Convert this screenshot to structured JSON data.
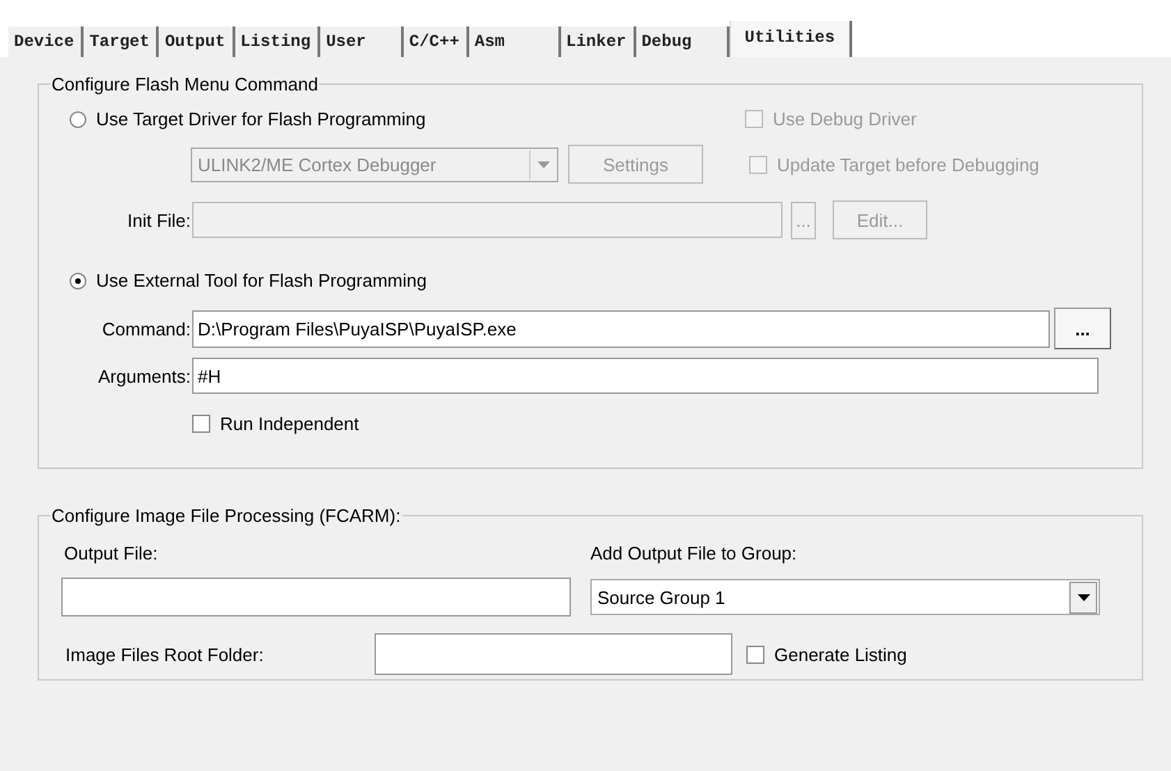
{
  "tabs": [
    {
      "label": "Device",
      "selected": false
    },
    {
      "label": "Target",
      "selected": false
    },
    {
      "label": "Output",
      "selected": false
    },
    {
      "label": "Listing",
      "selected": false
    },
    {
      "label": "User",
      "selected": false
    },
    {
      "label": "C/C++",
      "selected": false
    },
    {
      "label": "Asm",
      "selected": false
    },
    {
      "label": "Linker",
      "selected": false
    },
    {
      "label": "Debug",
      "selected": false
    },
    {
      "label": "Utilities",
      "selected": true
    }
  ],
  "flash_menu": {
    "title": "Configure Flash Menu Command",
    "target_driver": {
      "label": "Use Target Driver for Flash Programming",
      "selected": false
    },
    "use_debug_driver": {
      "label": "Use Debug Driver",
      "checked": false,
      "disabled": true
    },
    "driver": {
      "value": "ULINK2/ME Cortex Debugger",
      "disabled": true
    },
    "settings_button": {
      "label": "Settings",
      "disabled": true
    },
    "update_target": {
      "label": "Update Target before Debugging",
      "checked": false,
      "disabled": true
    },
    "init_file": {
      "label": "Init File:",
      "disabled": true
    },
    "init_browse": {
      "label": "...",
      "disabled": true
    },
    "edit_button": {
      "label": "Edit...",
      "disabled": true
    },
    "external_tool": {
      "label": "Use External Tool for Flash Programming",
      "selected": true
    },
    "command": {
      "label": "Command:",
      "value": "D:\\Program Files\\PuyaISP\\PuyaISP.exe"
    },
    "command_browse": {
      "label": "..."
    },
    "arguments": {
      "label": "Arguments:",
      "value": "#H"
    },
    "run_independent": {
      "label": "Run Independent",
      "checked": false
    }
  },
  "image_processing": {
    "title": "Configure Image File Processing (FCARM):",
    "output_file": {
      "label": "Output File:"
    },
    "add_to_group": {
      "label": "Add Output File to Group:",
      "value": "Source Group 1"
    },
    "root_folder": {
      "label": "Image Files Root Folder:"
    },
    "generate_listing": {
      "label": "Generate Listing",
      "checked": false
    }
  }
}
